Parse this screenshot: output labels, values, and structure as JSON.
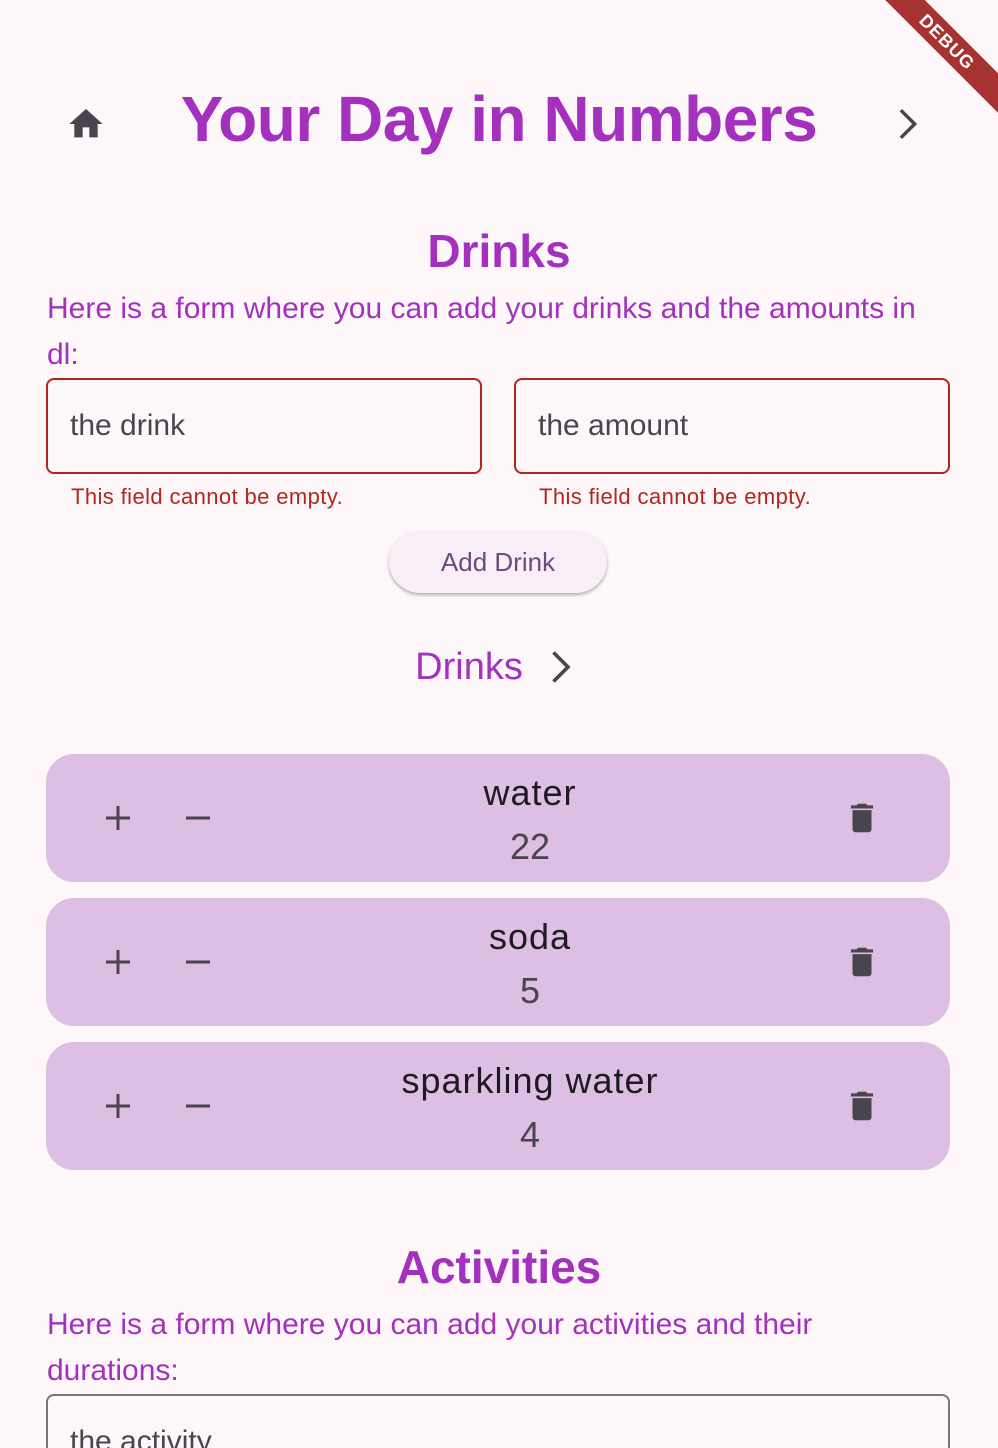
{
  "app_bar": {
    "title": "Your Day in Numbers",
    "home_icon": "home-icon",
    "next_icon": "chevron-right-icon",
    "debug_label": "DEBUG"
  },
  "drinks_section": {
    "title": "Drinks",
    "description": "Here is a form where you can add your drinks and the amounts in dl:",
    "drink_field": {
      "placeholder": "the drink",
      "value": "",
      "error": "This field cannot be empty."
    },
    "amount_field": {
      "placeholder": "the amount",
      "value": "",
      "error": "This field cannot be empty."
    },
    "add_button_label": "Add Drink",
    "list_link_label": "Drinks",
    "items": [
      {
        "name": "water",
        "amount": "22"
      },
      {
        "name": "soda",
        "amount": "5"
      },
      {
        "name": "sparkling water",
        "amount": "4"
      }
    ]
  },
  "activities_section": {
    "title": "Activities",
    "description": "Here is a form where you can add your activities and their durations:",
    "activity_field": {
      "placeholder": "the activity",
      "value": ""
    }
  },
  "colors": {
    "accent": "#a431be",
    "error": "#b3261e",
    "card_bg": "#dcbfe2",
    "background": "#fdf7fa",
    "icon": "#49454f"
  }
}
